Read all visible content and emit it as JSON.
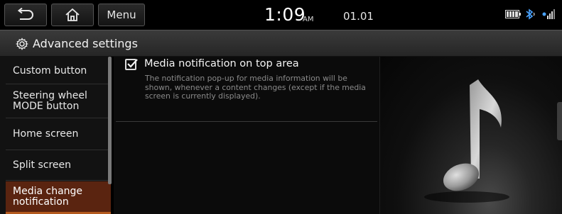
{
  "header": {
    "menu_label": "Menu",
    "time": "1:09",
    "ampm": "AM",
    "date": "01.01",
    "icons": [
      "back-arrow-icon",
      "home-icon",
      "battery-icon",
      "bluetooth-icon",
      "signal-icon"
    ]
  },
  "page": {
    "title": "Advanced settings",
    "title_icon": "gear-icon"
  },
  "sidebar": {
    "items": [
      {
        "label": "Custom button",
        "active": false
      },
      {
        "label": "Steering wheel\nMODE button",
        "active": false
      },
      {
        "label": "Home screen",
        "active": false
      },
      {
        "label": "Split screen",
        "active": false
      },
      {
        "label": "Media change\nnotification",
        "active": true
      }
    ]
  },
  "main": {
    "option": {
      "label": "Media notification on top area",
      "checked": true,
      "description": "The notification pop-up for media information will be shown, whenever a content changes (except if the media screen is currently displayed)."
    }
  },
  "illustration": {
    "icon": "music-note-icon"
  },
  "colors": {
    "active_item": "#5a2410",
    "active_underline": "#b45a1f",
    "background": "#000000"
  }
}
